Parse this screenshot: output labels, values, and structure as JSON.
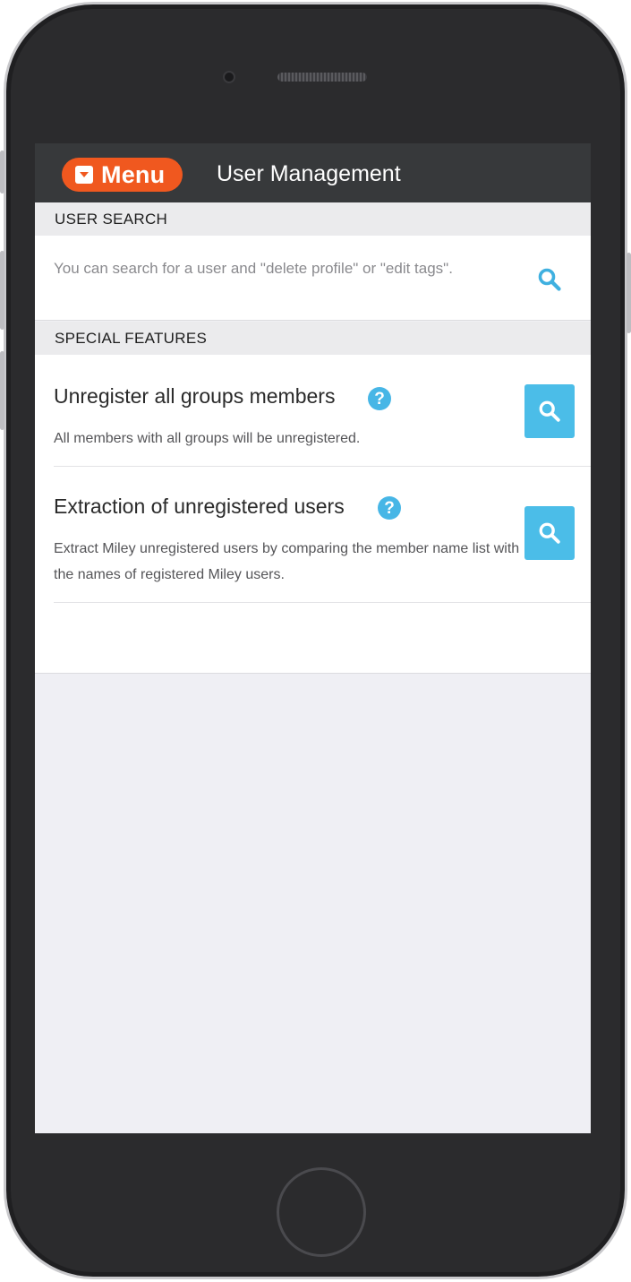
{
  "navbar": {
    "menu_label": "Menu",
    "title": "User Management"
  },
  "user_search": {
    "header": "USER SEARCH",
    "description": "You can search for a user and \"delete profile\" or \"edit tags\".",
    "icon": "search-icon"
  },
  "special_features": {
    "header": "SPECIAL FEATURES",
    "items": [
      {
        "title": "Unregister all groups members",
        "help_glyph": "?",
        "description": "All members with all groups will be unregistered.",
        "icon": "search-icon"
      },
      {
        "title": "Extraction of unregistered users",
        "help_glyph": "?",
        "description": "Extract Miley unregistered users by comparing the member name list with the names of registered Miley users.",
        "icon": "search-icon"
      }
    ]
  },
  "colors": {
    "navbar_bg": "#37393b",
    "menu_accent": "#f0581f",
    "action_blue": "#4bbde8",
    "help_blue": "#47b6e6",
    "screen_bg": "#efeff4"
  }
}
